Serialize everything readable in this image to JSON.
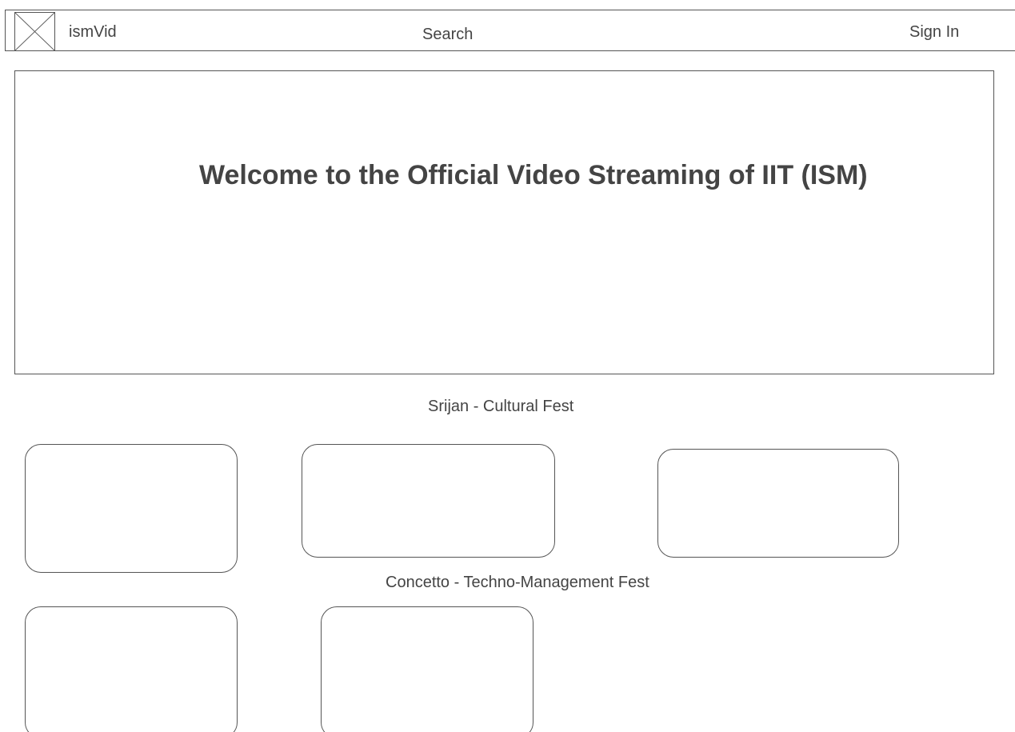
{
  "header": {
    "logo_icon": "image-placeholder-icon",
    "brand": "ismVid",
    "search_label": "Search",
    "signin_label": "Sign In"
  },
  "hero": {
    "title": "Welcome to the Official Video Streaming of IIT (ISM)"
  },
  "sections": [
    {
      "heading": "Srijan - Cultural Fest",
      "video_count": 3
    },
    {
      "heading": "Concetto - Techno-Management Fest",
      "video_count": 2
    }
  ],
  "colors": {
    "border": "#555555",
    "text": "#444444",
    "background": "#ffffff"
  }
}
